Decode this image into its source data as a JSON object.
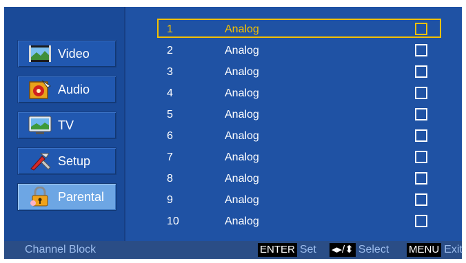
{
  "menu": {
    "items": [
      {
        "label": "Video",
        "icon": "video-icon"
      },
      {
        "label": "Audio",
        "icon": "audio-icon"
      },
      {
        "label": "TV",
        "icon": "tv-icon"
      },
      {
        "label": "Setup",
        "icon": "setup-tools-icon"
      },
      {
        "label": "Parental",
        "icon": "parental-lock-icon"
      }
    ],
    "active": "Parental"
  },
  "channels": [
    {
      "num": "1",
      "type": "Analog",
      "blocked": false
    },
    {
      "num": "2",
      "type": "Analog",
      "blocked": false
    },
    {
      "num": "3",
      "type": "Analog",
      "blocked": false
    },
    {
      "num": "4",
      "type": "Analog",
      "blocked": false
    },
    {
      "num": "5",
      "type": "Analog",
      "blocked": false
    },
    {
      "num": "6",
      "type": "Analog",
      "blocked": false
    },
    {
      "num": "7",
      "type": "Analog",
      "blocked": false
    },
    {
      "num": "8",
      "type": "Analog",
      "blocked": false
    },
    {
      "num": "9",
      "type": "Analog",
      "blocked": false
    },
    {
      "num": "10",
      "type": "Analog",
      "blocked": false
    }
  ],
  "selected_row": 1,
  "footer": {
    "title": "Channel Block",
    "enter_key": "ENTER",
    "enter_label": "Set",
    "arrow_key": "◂▸/⬍",
    "arrow_label": "Select",
    "menu_key": "MENU",
    "menu_label": "Exit"
  },
  "colors": {
    "background": "#1f52a4",
    "highlight": "#f5c000",
    "active_item": "#6da6e4",
    "footer_text": "#9cbcec"
  }
}
